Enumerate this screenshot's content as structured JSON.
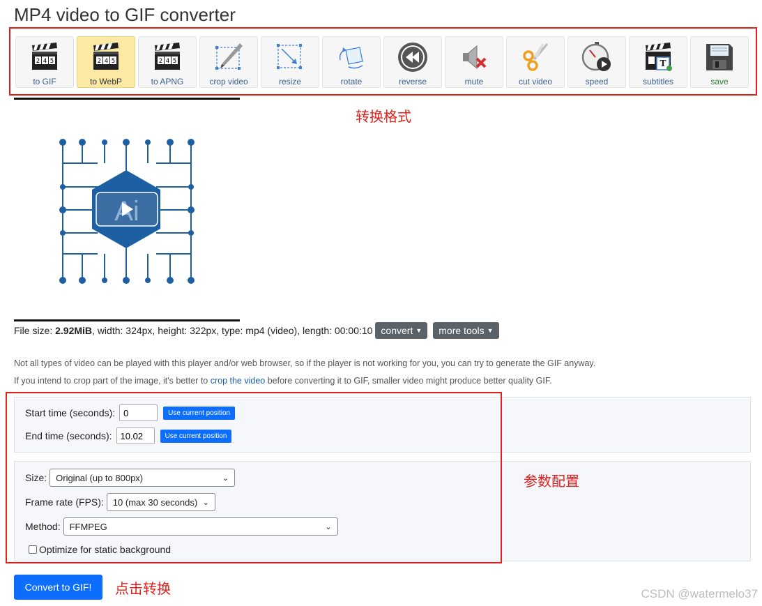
{
  "page": {
    "title": "MP4 video to GIF converter"
  },
  "toolbar": {
    "items": [
      {
        "label": "to GIF",
        "icon": "clapperboard-icon"
      },
      {
        "label": "to WebP",
        "icon": "clapperboard-icon",
        "active": true
      },
      {
        "label": "to APNG",
        "icon": "clapperboard-icon"
      },
      {
        "label": "crop video",
        "icon": "crop-icon"
      },
      {
        "label": "resize",
        "icon": "resize-icon"
      },
      {
        "label": "rotate",
        "icon": "rotate-icon"
      },
      {
        "label": "reverse",
        "icon": "reverse-icon"
      },
      {
        "label": "mute",
        "icon": "mute-icon"
      },
      {
        "label": "cut video",
        "icon": "scissors-icon"
      },
      {
        "label": "speed",
        "icon": "stopwatch-icon"
      },
      {
        "label": "subtitles",
        "icon": "subtitles-icon"
      },
      {
        "label": "save",
        "icon": "floppy-disk-icon"
      }
    ],
    "clapper_numbers": "2 4 5"
  },
  "annotations": {
    "format_label": "转换格式",
    "params_label": "参数配置",
    "click_label": "点击转换",
    "color": "#e0201c"
  },
  "video": {
    "logo_text": "Ai",
    "accent": "#1d5fa3"
  },
  "file_info": {
    "prefix": "File size: ",
    "size": "2.92MiB",
    "details": ", width: 324px, height: 322px, type: mp4 (video), length: 00:00:10",
    "convert_button": "convert",
    "more_tools_button": "more tools"
  },
  "notes": {
    "line1": "Not all types of video can be played with this player and/or web browser, so if the player is not working for you, you can try to generate the GIF anyway.",
    "line2_before": "If you intend to crop part of the image, it's better to ",
    "line2_link": "crop the video",
    "line2_after": " before converting it to GIF, smaller video might produce better quality GIF."
  },
  "time_settings": {
    "start_label": "Start time (seconds):",
    "start_value": "0",
    "end_label": "End time (seconds):",
    "end_value": "10.02",
    "use_position_button": "Use current position"
  },
  "options": {
    "size_label": "Size:",
    "size_value": "Original (up to 800px)",
    "fps_label": "Frame rate (FPS):",
    "fps_value": "10 (max 30 seconds)",
    "method_label": "Method:",
    "method_value": "FFMPEG",
    "optimize_label": "Optimize for static background",
    "optimize_checked": false
  },
  "actions": {
    "convert_label": "Convert to GIF!"
  },
  "watermark": "CSDN @watermelo37"
}
